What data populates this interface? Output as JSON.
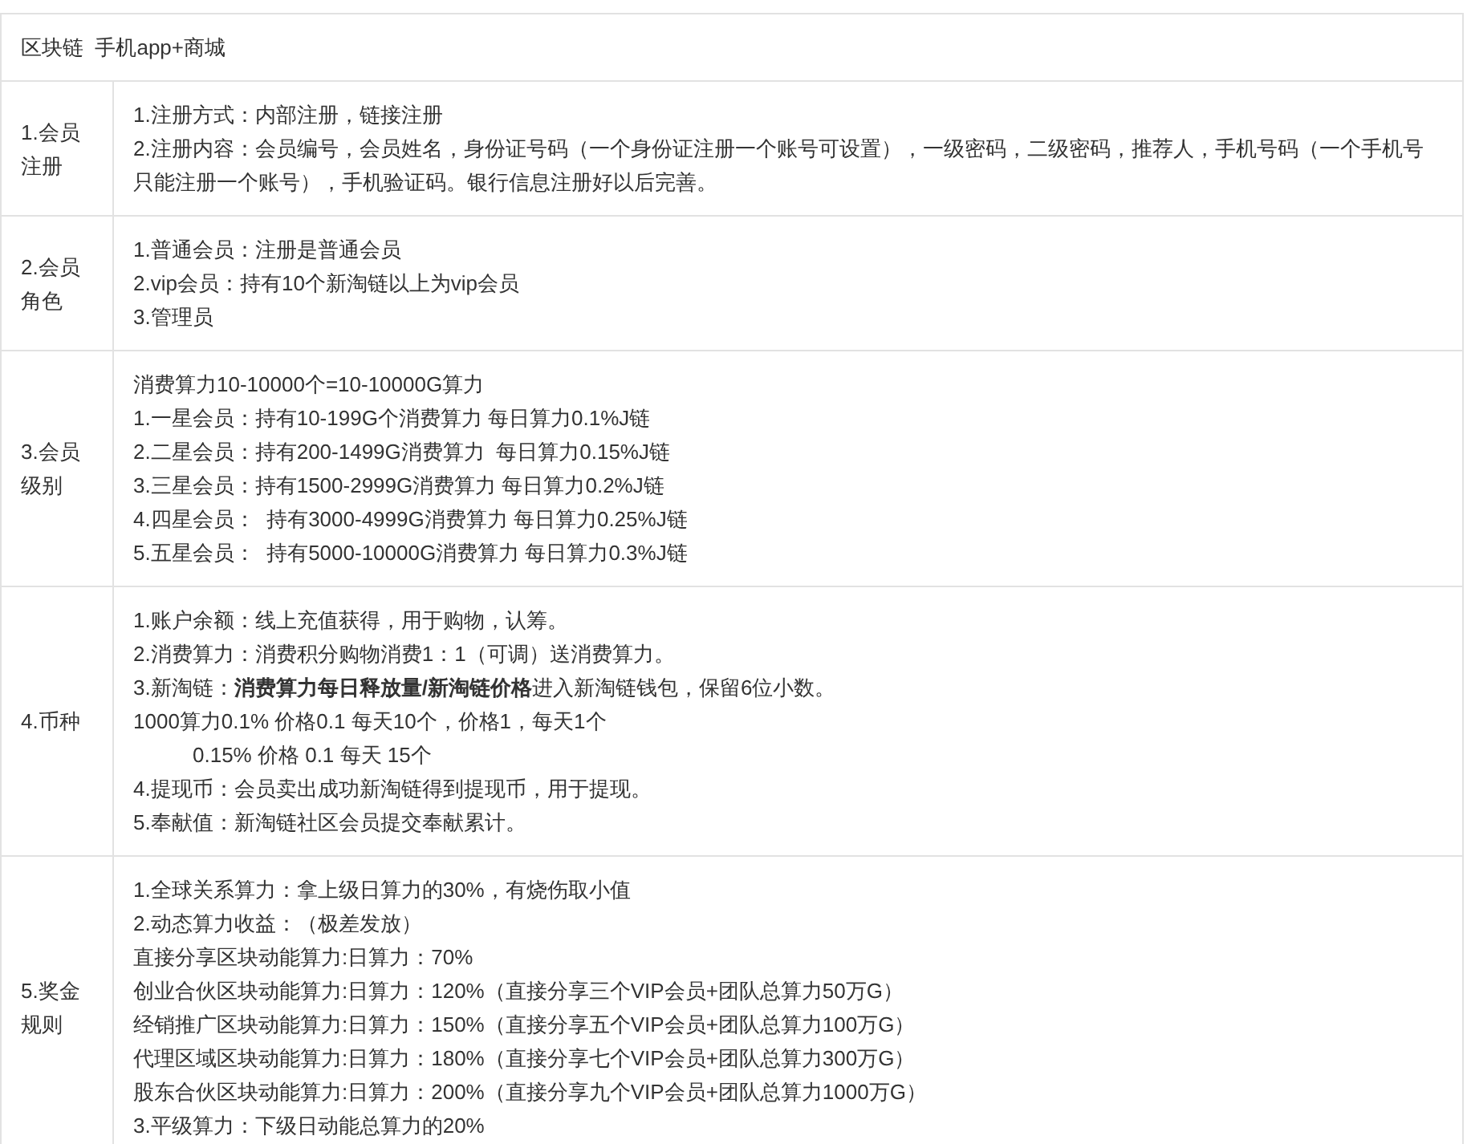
{
  "title": "区块链  手机app+商城",
  "rows": [
    {
      "label": "1.会员注册",
      "lines": [
        {
          "kind": "plain",
          "text": "1.注册方式：内部注册，链接注册"
        },
        {
          "kind": "plain",
          "text": "2.注册内容：会员编号，会员姓名，身份证号码（一个身份证注册一个账号可设置），一级密码，二级密码，推荐人，手机号码（一个手机号只能注册一个账号），手机验证码。银行信息注册好以后完善。"
        }
      ]
    },
    {
      "label": "2.会员角色",
      "lines": [
        {
          "kind": "plain",
          "text": "1.普通会员：注册是普通会员"
        },
        {
          "kind": "plain",
          "text": "2.vip会员：持有10个新淘链以上为vip会员"
        },
        {
          "kind": "plain",
          "text": "3.管理员"
        }
      ]
    },
    {
      "label": "3.会员级别",
      "lines": [
        {
          "kind": "plain",
          "text": "消费算力10-10000个=10-10000G算力"
        },
        {
          "kind": "plain",
          "text": "1.一星会员：持有10-199G个消费算力 每日算力0.1%J链"
        },
        {
          "kind": "plain",
          "text": "2.二星会员：持有200-1499G消费算力  每日算力0.15%J链"
        },
        {
          "kind": "plain",
          "text": "3.三星会员：持有1500-2999G消费算力 每日算力0.2%J链"
        },
        {
          "kind": "plain",
          "text": "4.四星会员：  持有3000-4999G消费算力 每日算力0.25%J链"
        },
        {
          "kind": "plain",
          "text": "5.五星会员：  持有5000-10000G消费算力 每日算力0.3%J链"
        }
      ]
    },
    {
      "label": "4.币种",
      "lines": [
        {
          "kind": "plain",
          "text": "1.账户余额：线上充值获得，用于购物，认筹。"
        },
        {
          "kind": "plain",
          "text": "2.消费算力：消费积分购物消费1：1（可调）送消费算力。"
        },
        {
          "kind": "plain",
          "text": "3.新淘链：**消费算力每日释放量/新淘链价格**进入新淘链钱包，保留6位小数。"
        },
        {
          "kind": "plain",
          "text": "1000算力0.1% 价格0.1 每天10个，价格1，每天1个"
        },
        {
          "kind": "indented",
          "text": "0.15% 价格 0.1 每天 15个"
        },
        {
          "kind": "plain",
          "text": "4.提现币：会员卖出成功新淘链得到提现币，用于提现。"
        },
        {
          "kind": "plain",
          "text": "5.奉献值：新淘链社区会员提交奉献累计。"
        }
      ]
    },
    {
      "label": "5.奖金规则",
      "lines": [
        {
          "kind": "plain",
          "text": "1.全球关系算力：拿上级日算力的30%，有烧伤取小值"
        },
        {
          "kind": "plain",
          "text": "2.动态算力收益：（极差发放）"
        },
        {
          "kind": "plain",
          "text": "直接分享区块动能算力:日算力：70%"
        },
        {
          "kind": "plain",
          "text": "创业合伙区块动能算力:日算力：120%（直接分享三个VIP会员+团队总算力50万G）"
        },
        {
          "kind": "plain",
          "text": "经销推广区块动能算力:日算力：150%（直接分享五个VIP会员+团队总算力100万G）"
        },
        {
          "kind": "plain",
          "text": "代理区域区块动能算力:日算力：180%（直接分享七个VIP会员+团队总算力300万G）"
        },
        {
          "kind": "plain",
          "text": "股东合伙区块动能算力:日算力：200%（直接分享九个VIP会员+团队总算力1000万G）"
        },
        {
          "kind": "plain",
          "text": "3.平级算力：下级日动能总算力的20%"
        }
      ]
    }
  ]
}
